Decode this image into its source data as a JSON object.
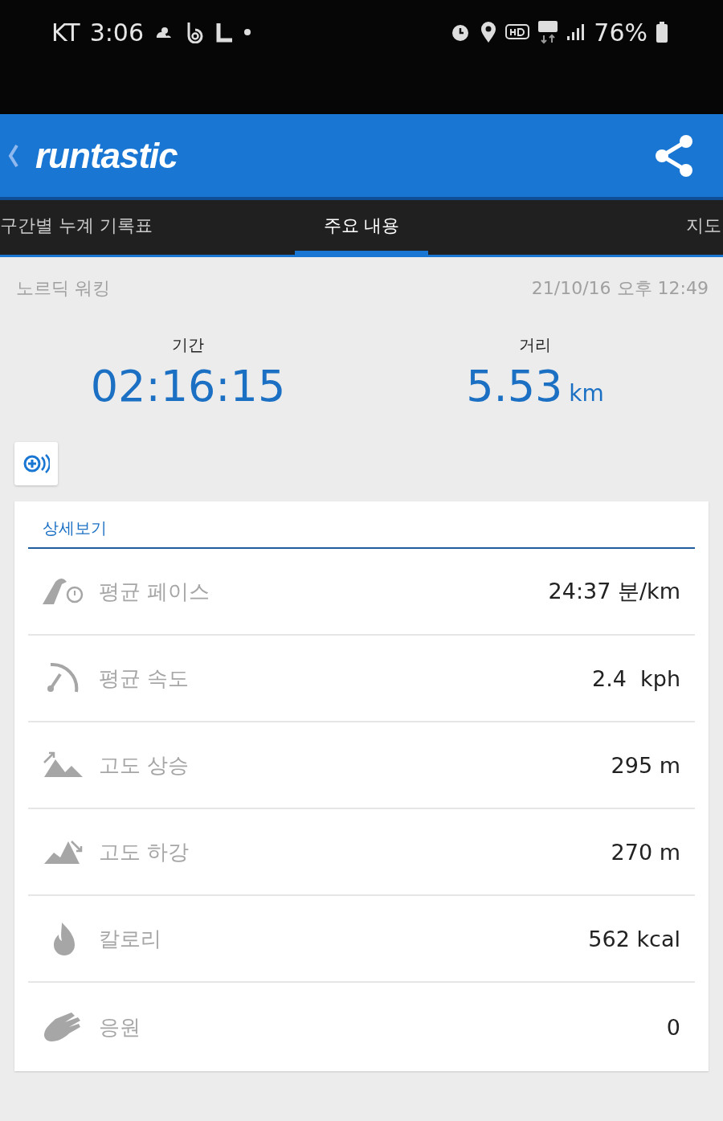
{
  "status_bar": {
    "carrier": "KT",
    "time": "3:06",
    "battery": "76%"
  },
  "app_bar": {
    "logo": "runtastic"
  },
  "tabs": [
    {
      "label": "구간별 누계 기록표",
      "selected": false
    },
    {
      "label": "주요 내용",
      "selected": true
    },
    {
      "label": "지도",
      "selected": false
    }
  ],
  "activity": {
    "type": "노르딕 워킹",
    "date": "21/10/16 오후 12:49"
  },
  "summary": [
    {
      "label": "기간",
      "value": "02:16:15"
    },
    {
      "label": "거리",
      "value": "5.53",
      "unit": "km"
    }
  ],
  "details": {
    "title": "상세보기",
    "rows": [
      {
        "kind": "pace",
        "label": "평균 페이스",
        "value": "24:37 분/km"
      },
      {
        "kind": "speed",
        "label": "평균 속도",
        "value": "2.4  kph"
      },
      {
        "kind": "ascent",
        "label": "고도 상승",
        "value": "295 m"
      },
      {
        "kind": "descent",
        "label": "고도 하강",
        "value": "270 m"
      },
      {
        "kind": "calories",
        "label": "칼로리",
        "value": "562 kcal"
      },
      {
        "kind": "cheers",
        "label": "응원",
        "value": "0"
      }
    ]
  }
}
